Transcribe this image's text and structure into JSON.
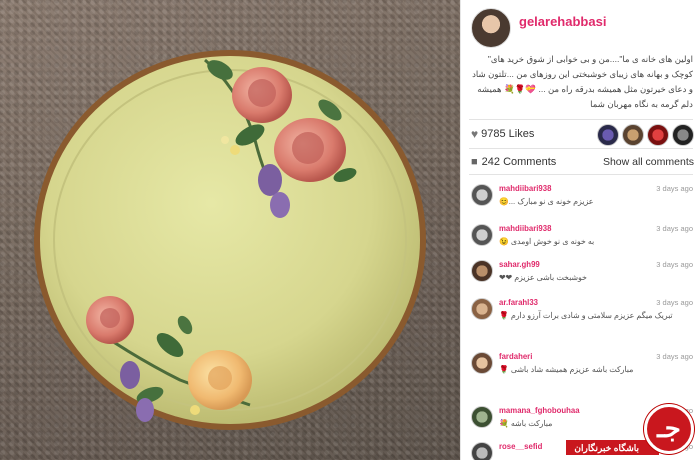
{
  "post": {
    "username": "gelarehabbasi",
    "caption": "اولین های خانه ی ما\"....من و بی خوابی از شوق خرید های\" کوچک و بهانه های زیبای خوشبختی این روزهای من ...تلتون شاد و دعای خیرتون مثل همیشه بدرقه راه من ... 💝🌹💐 همیشه دلم گرمه به نگاه مهربان شما"
  },
  "likes": {
    "count_label": "9785 Likes",
    "icon": "heart-icon"
  },
  "comments_header": {
    "count_label": "242 Comments",
    "show_all": "Show all comments",
    "icon": "comment-bubble-icon"
  },
  "comments": [
    {
      "user": "mahdiibari938",
      "time": "3 days ago",
      "text": "عزیزم خونه ی نو مبارک ...😊"
    },
    {
      "user": "mahdiibari938",
      "time": "3 days ago",
      "text": "به خونه ی نو خوش اومدی 😉"
    },
    {
      "user": "sahar.gh99",
      "time": "3 days ago",
      "text": "خوشبخت باشی عزیزم ❤❤"
    },
    {
      "user": "ar.farahl33",
      "time": "3 days ago",
      "text": "تبریک میگم عزیزم سلامتی و شادی برات آرزو دارم 🌹"
    },
    {
      "user": "fardaheri",
      "time": "3 days ago",
      "text": "مبارکت باشه عزیزم همیشه شاد باشی 🌹"
    },
    {
      "user": "mamana_fghobouhaa",
      "time": "3 days ago",
      "text": "مبارکت باشه 💐"
    },
    {
      "user": "rose__sefid",
      "time": "3 days ago",
      "text": ""
    }
  ],
  "watermark": {
    "text": "باشگاه خبرنگاران",
    "logo_glyph": "جـ"
  },
  "colors": {
    "accent": "#e02a6b",
    "watermark_red": "#c9171e"
  }
}
